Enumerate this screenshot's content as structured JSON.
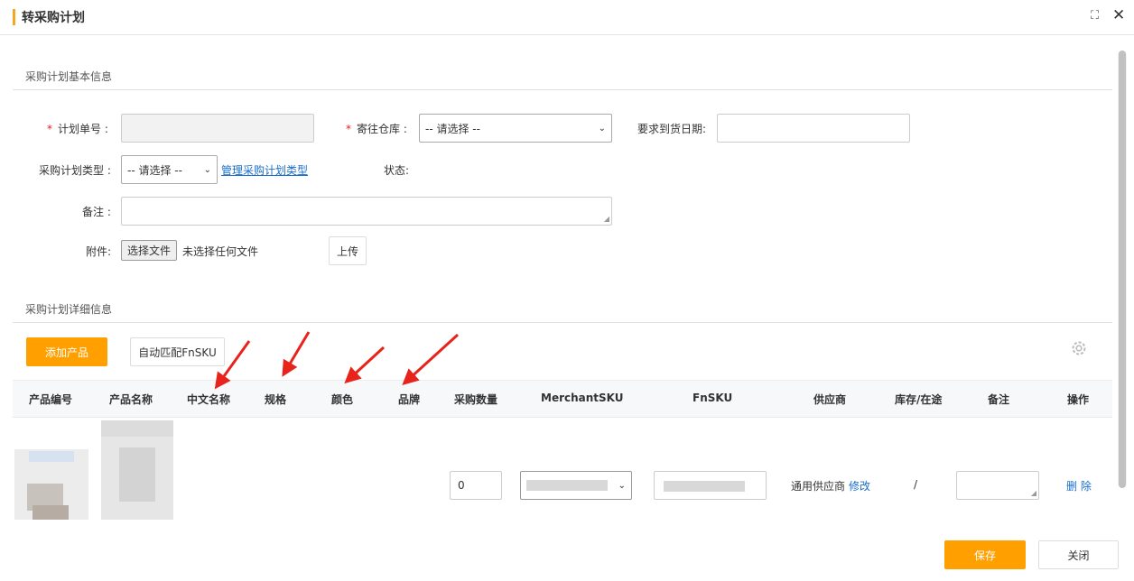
{
  "dialog": {
    "title": "转采购计划",
    "maximize_glyph": "⛶",
    "close_glyph": "✕"
  },
  "basic": {
    "section_title": "采购计划基本信息",
    "plan_no_label": "计划单号",
    "warehouse_label": "寄往仓库",
    "warehouse_value": "-- 请选择 --",
    "arrival_date_label": "要求到货日期:",
    "plan_type_label": "采购计划类型",
    "plan_type_value": "-- 请选择 --",
    "manage_type_link": "管理采购计划类型",
    "status_label": "状态:",
    "remark_label": "备注",
    "attach_label": "附件:",
    "choose_file_btn": "选择文件",
    "no_file_text": "未选择任何文件",
    "upload_btn": "上传",
    "req_mark": "*",
    "colon": ":"
  },
  "detail": {
    "section_title": "采购计划详细信息",
    "add_product_btn": "添加产品",
    "auto_match_btn": "自动匹配FnSKU",
    "columns": [
      "产品编号",
      "产品名称",
      "中文名称",
      "规格",
      "颜色",
      "品牌",
      "采购数量",
      "MerchantSKU",
      "FnSKU",
      "供应商",
      "库存/在途",
      "备注",
      "操作"
    ],
    "row": {
      "qty_value": "0",
      "supplier_text": "通用供应商",
      "modify_link": "修改",
      "stock_text": "/",
      "delete_link": "删 除"
    }
  },
  "footer": {
    "save_btn": "保存",
    "close_btn": "关闭"
  },
  "colors": {
    "accent": "#ffa000",
    "link": "#1a6ec7",
    "required": "#e02020",
    "arrow": "#e8231b"
  }
}
